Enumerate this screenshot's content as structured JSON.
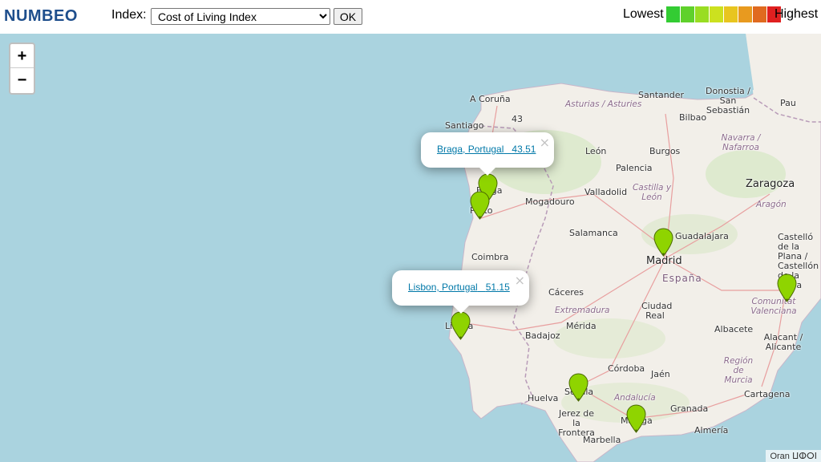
{
  "header": {
    "logo": "NUMBEO",
    "index_label": "Index:",
    "index_selected": "Cost of Living Index",
    "ok_label": "OK",
    "legend_low": "Lowest",
    "legend_high": "Highest",
    "legend_colors": [
      "#33cc33",
      "#5fd12b",
      "#99dd22",
      "#cce11f",
      "#e8c51f",
      "#e89a1f",
      "#e06a1f",
      "#e02020"
    ]
  },
  "zoom": {
    "in": "+",
    "out": "−"
  },
  "markers": {
    "color": "#8fd400"
  },
  "popups": [
    {
      "city": "Braga, Portugal",
      "value": "43.51",
      "close": "×"
    },
    {
      "city": "Lisbon, Portugal",
      "value": "51.15",
      "close": "×"
    }
  ],
  "places": {
    "a_coruna": "A Coruña",
    "santiago": "Santiago",
    "braga": "Braga",
    "porto": "Porto",
    "coimbra": "Coimbra",
    "lisboa": "Lisboa",
    "mogadouro": "Mogadouro",
    "salamanca": "Salamanca",
    "caceres": "Cáceres",
    "extremadura": "Extremadura",
    "merida": "Mérida",
    "badajoz": "Badajoz",
    "huelva": "Huelva",
    "sevilla": "Sevilla",
    "jerez": "Jerez de la Frontera",
    "malaga": "Málaga",
    "marbella": "Marbella",
    "andalucia": "Andalucía",
    "cordoba": "Córdoba",
    "jaen": "Jaén",
    "granada": "Granada",
    "almeria": "Almería",
    "region_murcia": "Región de Murcia",
    "cartagena": "Cartagena",
    "alacant": "Alacant / Alicante",
    "albacete": "Albacete",
    "ciudad_real": "Ciudad Real",
    "madrid": "Madrid",
    "guadalajara": "Guadalajara",
    "espana": "España",
    "castilla_leon": "Castilla y León",
    "valladolid": "Valladolid",
    "palencia": "Palencia",
    "burgos": "Burgos",
    "leon": "León",
    "asturias": "Asturias / Asturies",
    "santander": "Santander",
    "bilbao": "Bilbao",
    "donostia": "Donostia / San Sebastián",
    "navarra": "Navarra / Nafarroa",
    "pau": "Pau",
    "zaragoza": "Zaragoza",
    "aragon": "Aragón",
    "castello": "Castelló de la Plana / Castellón de la Plana",
    "comunitat": "Comunitat Valenciana",
    "oran": "Oran ⵡⵀⵔⵏ",
    "n43": "43"
  }
}
